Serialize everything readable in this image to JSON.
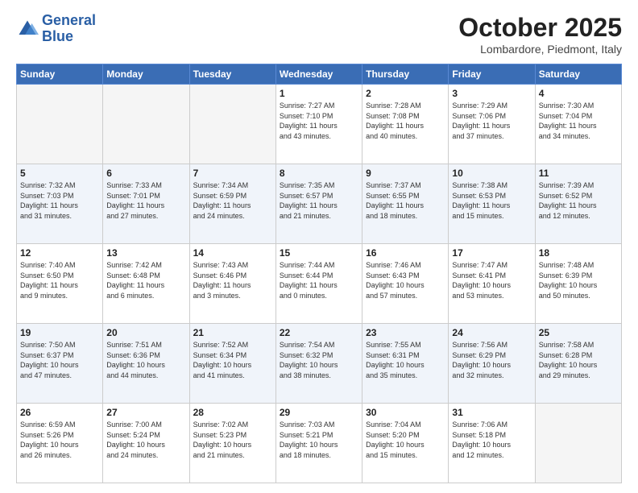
{
  "header": {
    "logo_line1": "General",
    "logo_line2": "Blue",
    "month": "October 2025",
    "location": "Lombardore, Piedmont, Italy"
  },
  "days_of_week": [
    "Sunday",
    "Monday",
    "Tuesday",
    "Wednesday",
    "Thursday",
    "Friday",
    "Saturday"
  ],
  "weeks": [
    [
      {
        "day": "",
        "info": ""
      },
      {
        "day": "",
        "info": ""
      },
      {
        "day": "",
        "info": ""
      },
      {
        "day": "1",
        "info": "Sunrise: 7:27 AM\nSunset: 7:10 PM\nDaylight: 11 hours\nand 43 minutes."
      },
      {
        "day": "2",
        "info": "Sunrise: 7:28 AM\nSunset: 7:08 PM\nDaylight: 11 hours\nand 40 minutes."
      },
      {
        "day": "3",
        "info": "Sunrise: 7:29 AM\nSunset: 7:06 PM\nDaylight: 11 hours\nand 37 minutes."
      },
      {
        "day": "4",
        "info": "Sunrise: 7:30 AM\nSunset: 7:04 PM\nDaylight: 11 hours\nand 34 minutes."
      }
    ],
    [
      {
        "day": "5",
        "info": "Sunrise: 7:32 AM\nSunset: 7:03 PM\nDaylight: 11 hours\nand 31 minutes."
      },
      {
        "day": "6",
        "info": "Sunrise: 7:33 AM\nSunset: 7:01 PM\nDaylight: 11 hours\nand 27 minutes."
      },
      {
        "day": "7",
        "info": "Sunrise: 7:34 AM\nSunset: 6:59 PM\nDaylight: 11 hours\nand 24 minutes."
      },
      {
        "day": "8",
        "info": "Sunrise: 7:35 AM\nSunset: 6:57 PM\nDaylight: 11 hours\nand 21 minutes."
      },
      {
        "day": "9",
        "info": "Sunrise: 7:37 AM\nSunset: 6:55 PM\nDaylight: 11 hours\nand 18 minutes."
      },
      {
        "day": "10",
        "info": "Sunrise: 7:38 AM\nSunset: 6:53 PM\nDaylight: 11 hours\nand 15 minutes."
      },
      {
        "day": "11",
        "info": "Sunrise: 7:39 AM\nSunset: 6:52 PM\nDaylight: 11 hours\nand 12 minutes."
      }
    ],
    [
      {
        "day": "12",
        "info": "Sunrise: 7:40 AM\nSunset: 6:50 PM\nDaylight: 11 hours\nand 9 minutes."
      },
      {
        "day": "13",
        "info": "Sunrise: 7:42 AM\nSunset: 6:48 PM\nDaylight: 11 hours\nand 6 minutes."
      },
      {
        "day": "14",
        "info": "Sunrise: 7:43 AM\nSunset: 6:46 PM\nDaylight: 11 hours\nand 3 minutes."
      },
      {
        "day": "15",
        "info": "Sunrise: 7:44 AM\nSunset: 6:44 PM\nDaylight: 11 hours\nand 0 minutes."
      },
      {
        "day": "16",
        "info": "Sunrise: 7:46 AM\nSunset: 6:43 PM\nDaylight: 10 hours\nand 57 minutes."
      },
      {
        "day": "17",
        "info": "Sunrise: 7:47 AM\nSunset: 6:41 PM\nDaylight: 10 hours\nand 53 minutes."
      },
      {
        "day": "18",
        "info": "Sunrise: 7:48 AM\nSunset: 6:39 PM\nDaylight: 10 hours\nand 50 minutes."
      }
    ],
    [
      {
        "day": "19",
        "info": "Sunrise: 7:50 AM\nSunset: 6:37 PM\nDaylight: 10 hours\nand 47 minutes."
      },
      {
        "day": "20",
        "info": "Sunrise: 7:51 AM\nSunset: 6:36 PM\nDaylight: 10 hours\nand 44 minutes."
      },
      {
        "day": "21",
        "info": "Sunrise: 7:52 AM\nSunset: 6:34 PM\nDaylight: 10 hours\nand 41 minutes."
      },
      {
        "day": "22",
        "info": "Sunrise: 7:54 AM\nSunset: 6:32 PM\nDaylight: 10 hours\nand 38 minutes."
      },
      {
        "day": "23",
        "info": "Sunrise: 7:55 AM\nSunset: 6:31 PM\nDaylight: 10 hours\nand 35 minutes."
      },
      {
        "day": "24",
        "info": "Sunrise: 7:56 AM\nSunset: 6:29 PM\nDaylight: 10 hours\nand 32 minutes."
      },
      {
        "day": "25",
        "info": "Sunrise: 7:58 AM\nSunset: 6:28 PM\nDaylight: 10 hours\nand 29 minutes."
      }
    ],
    [
      {
        "day": "26",
        "info": "Sunrise: 6:59 AM\nSunset: 5:26 PM\nDaylight: 10 hours\nand 26 minutes."
      },
      {
        "day": "27",
        "info": "Sunrise: 7:00 AM\nSunset: 5:24 PM\nDaylight: 10 hours\nand 24 minutes."
      },
      {
        "day": "28",
        "info": "Sunrise: 7:02 AM\nSunset: 5:23 PM\nDaylight: 10 hours\nand 21 minutes."
      },
      {
        "day": "29",
        "info": "Sunrise: 7:03 AM\nSunset: 5:21 PM\nDaylight: 10 hours\nand 18 minutes."
      },
      {
        "day": "30",
        "info": "Sunrise: 7:04 AM\nSunset: 5:20 PM\nDaylight: 10 hours\nand 15 minutes."
      },
      {
        "day": "31",
        "info": "Sunrise: 7:06 AM\nSunset: 5:18 PM\nDaylight: 10 hours\nand 12 minutes."
      },
      {
        "day": "",
        "info": ""
      }
    ]
  ]
}
